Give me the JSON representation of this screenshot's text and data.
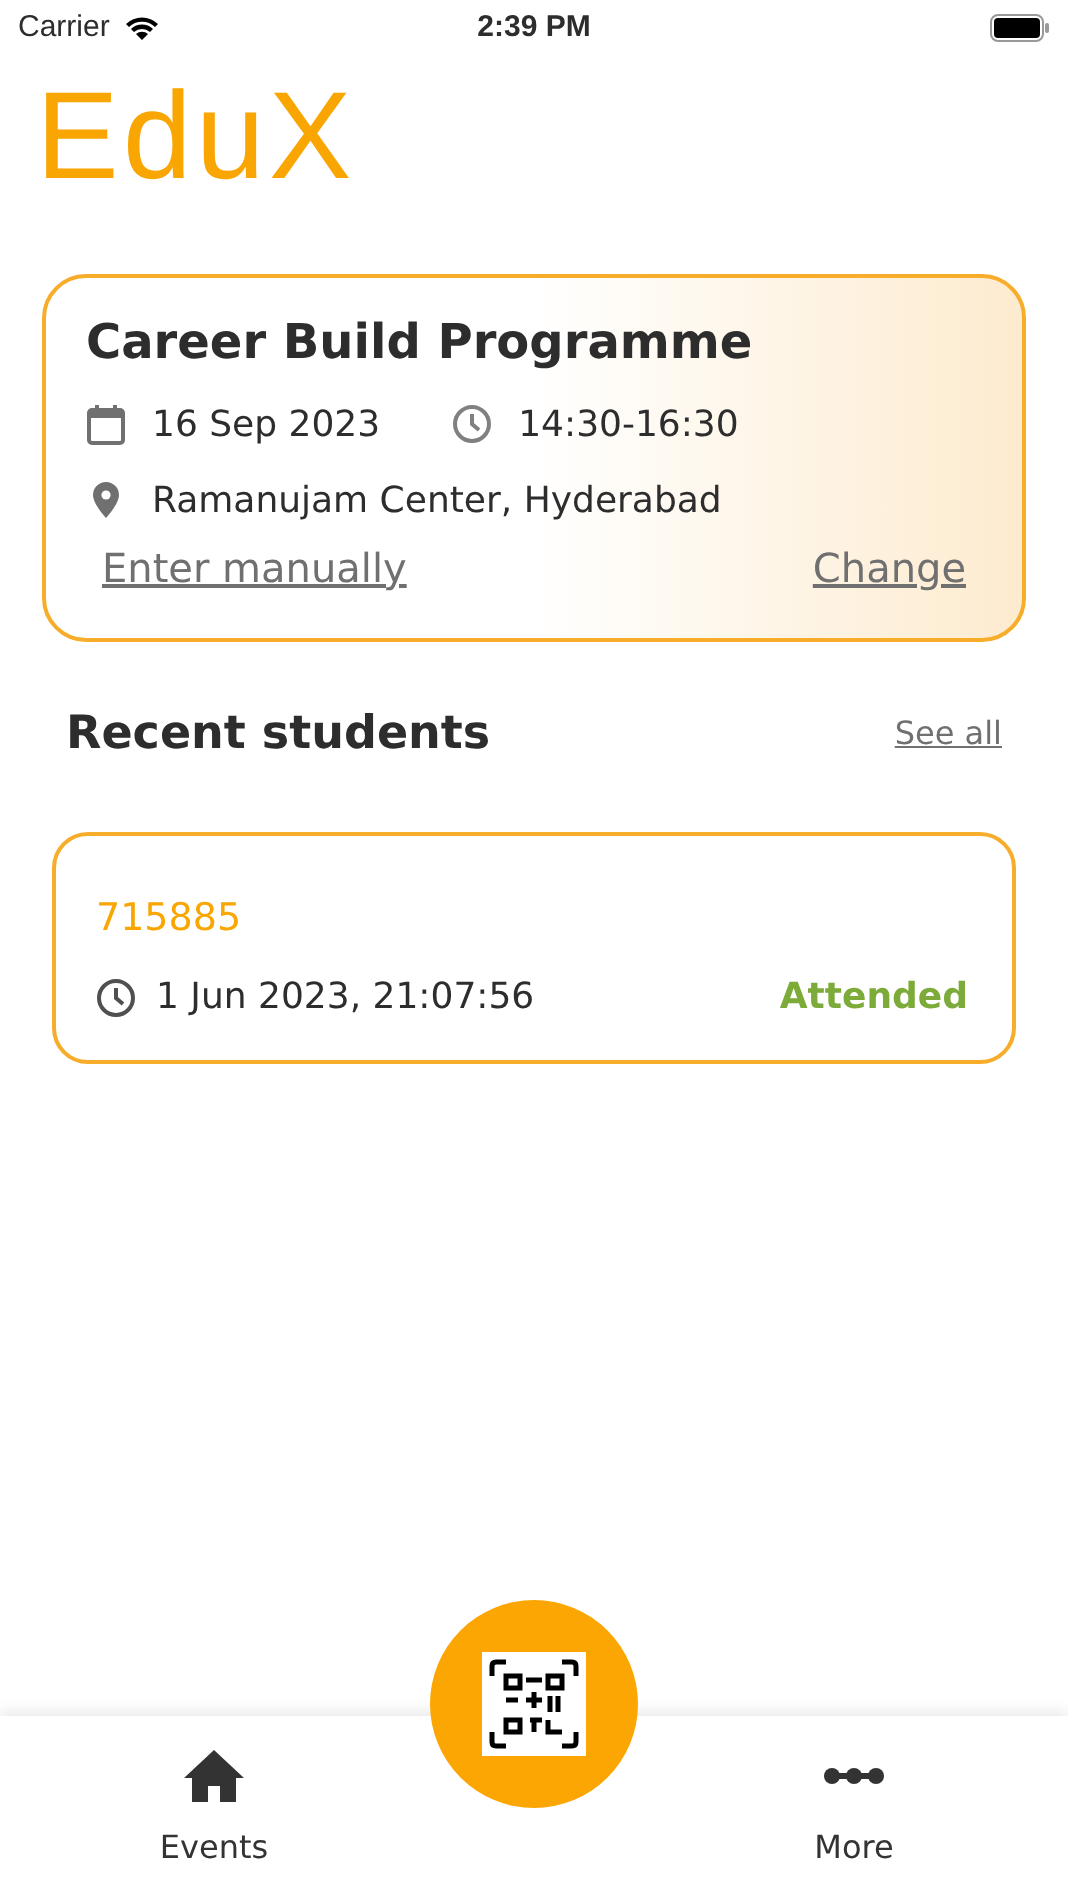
{
  "status_bar": {
    "carrier": "Carrier",
    "time": "2:39 PM"
  },
  "logo": "EduX",
  "event": {
    "title": "Career Build Programme",
    "date": "16 Sep 2023",
    "time": "14:30-16:30",
    "location": "Ramanujam Center, Hyderabad",
    "links": [
      "Enter manually",
      "Change"
    ]
  },
  "recent": {
    "title": "Recent students",
    "see_all": "See all",
    "students": [
      {
        "id": "715885",
        "timestamp": "1 Jun 2023, 21:07:56",
        "status": "Attended"
      }
    ]
  },
  "tab_bar": {
    "tabs": [
      {
        "label": "Events",
        "kind": "home"
      },
      {
        "label": "More",
        "kind": "more"
      }
    ]
  }
}
